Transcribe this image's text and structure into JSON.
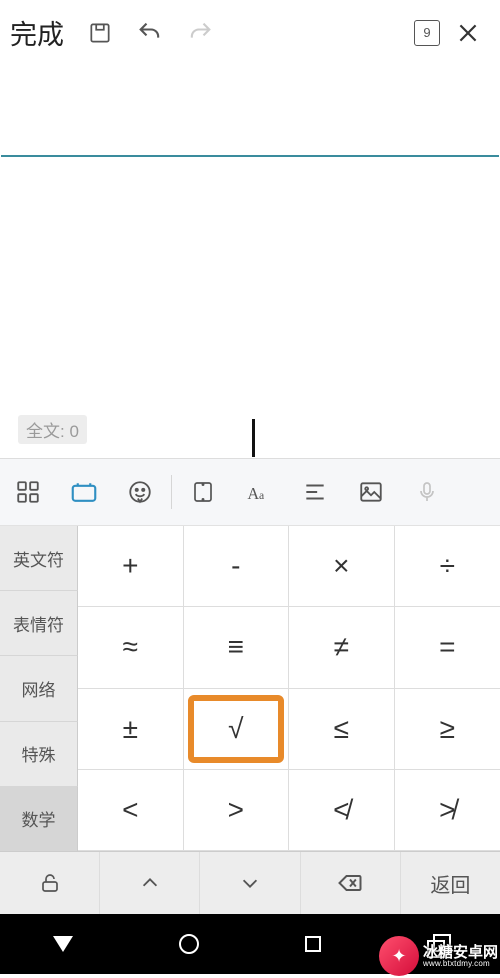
{
  "toolbar": {
    "done_label": "完成",
    "page_number": "9"
  },
  "document": {
    "word_count_label": "全文: 0"
  },
  "categories": {
    "0": "英文符",
    "1": "表情符",
    "2": "网络",
    "3": "特殊",
    "4": "数学"
  },
  "symbols": {
    "0": "+",
    "1": "-",
    "2": "×",
    "3": "÷",
    "4": "≈",
    "5": "≡",
    "6": "≠",
    "7": "=",
    "8": "±",
    "9": "√",
    "10": "≤",
    "11": "≥",
    "12": "<",
    "13": ">",
    "14": "≮",
    "15": "≯"
  },
  "kb_bottom": {
    "return_label": "返回"
  },
  "watermark": {
    "zh": "冰糖安卓网",
    "url": "www.btxtdmy.com"
  }
}
